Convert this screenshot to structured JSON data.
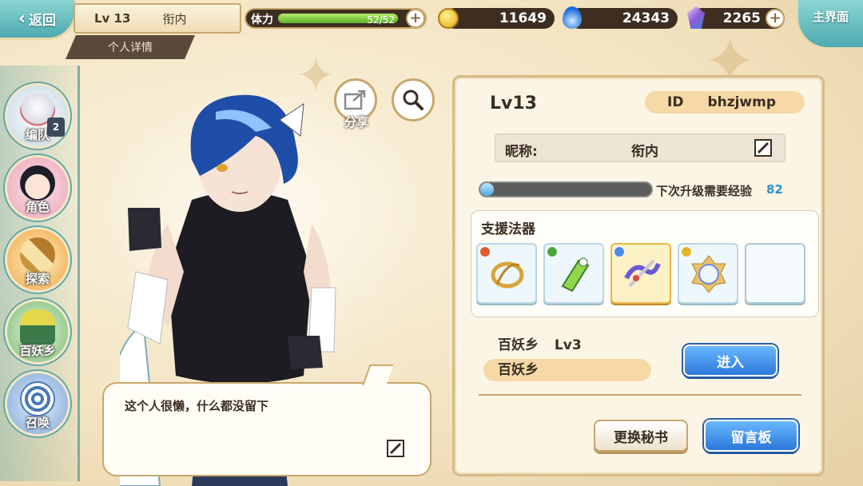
{
  "header": {
    "back_label": "返回",
    "level": "Lv 13",
    "player_name": "衔内",
    "detail_tab": "个人详情",
    "stamina_label": "体力",
    "stamina_value": "52/52",
    "stamina_fraction": 1.0,
    "coins": "11649",
    "soul_fire": "24343",
    "crystals": "2265",
    "main_menu_label": "主界面"
  },
  "sidebar": {
    "items": [
      {
        "label": "编队",
        "badge": "2"
      },
      {
        "label": "角色"
      },
      {
        "label": "探索"
      },
      {
        "label": "百妖乡"
      },
      {
        "label": "召唤"
      }
    ]
  },
  "character": {
    "share_label": "分享",
    "message": "这个人很懒，什么都没留下"
  },
  "profile": {
    "level": "Lv13",
    "id_label": "ID",
    "id_value": "bhzjwmp",
    "nickname_label": "昵称:",
    "nickname_value": "衔内",
    "exp_label": "下次升级需要经验",
    "exp_value": "82",
    "exp_fraction": 0.08,
    "support_title": "支援法器",
    "village_title": "百妖乡",
    "village_level": "Lv3",
    "village_name": "百妖乡",
    "enter_label": "进入",
    "change_secretary_label": "更换秘书",
    "message_board_label": "留言板"
  },
  "colors": {
    "accent_teal": "#4fa9b0",
    "button_blue": "#2b78d9",
    "exp_value": "#2b8fd4",
    "panel_bg": "#fbf5e6"
  }
}
